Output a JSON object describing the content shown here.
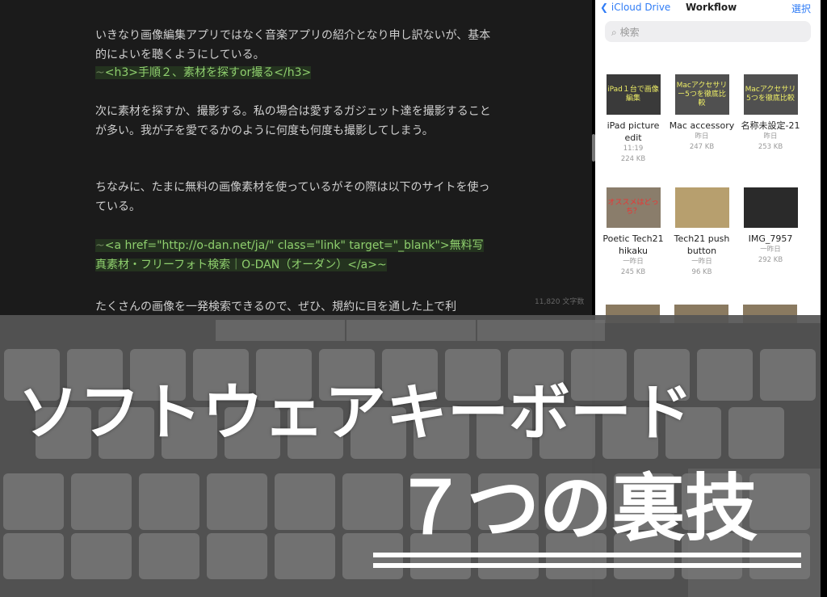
{
  "editor": {
    "paragraphs": [
      {
        "text": "いきなり画像編集アプリではなく音楽アプリの紹介となり申し訳ないが、基本的によいを聴くようにしている。"
      },
      {
        "tilde": "~",
        "text": "<h3>手順２、素材を探すor撮る</h3>"
      },
      {
        "text": "次に素材を探すか、撮影する。私の場合は愛するガジェット達を撮影することが多い。我が子を愛でるかのように何度も何度も撮影してしまう。"
      },
      {
        "text": "ちなみに、たまに無料の画像素材を使っているがその際は以下のサイトを使っている。"
      },
      {
        "tilde": "~",
        "text": "<a href=\"http://o-dan.net/ja/\" class=\"link\" target=\"_blank\">無料写真素材・フリーフォト検索｜O-DAN（オーダン）</a>~"
      },
      {
        "text": "たくさんの画像を一発検索できるので、ぜひ、規約に目を通した上で利"
      }
    ],
    "char_count": "11,820 文字数"
  },
  "files": {
    "back_label": "iCloud Drive",
    "title": "Workflow",
    "select_label": "選択",
    "search_placeholder": "検索",
    "items": [
      {
        "name": "iPad picture edit",
        "date": "11:19",
        "size": "224 KB",
        "thumb_text": "iPad１台で画像編集"
      },
      {
        "name": "Mac accessory",
        "date": "昨日",
        "size": "247 KB",
        "thumb_text": "Macアクセサリー5つを徹底比較"
      },
      {
        "name": "名称未設定-21",
        "date": "昨日",
        "size": "253 KB",
        "thumb_text": "Macアクセサリ5つを徹底比較"
      },
      {
        "name": "Poetic Tech21 hikaku",
        "date": "一昨日",
        "size": "245 KB",
        "thumb_text": "オススメはどっち？"
      },
      {
        "name": "Tech21 push button",
        "date": "一昨日",
        "size": "96 KB",
        "thumb_text": ""
      },
      {
        "name": "IMG_7957",
        "date": "一昨日",
        "size": "292 KB",
        "thumb_text": ""
      }
    ]
  },
  "overlay": {
    "title": "ソフトウェアキーボード",
    "subtitle": "７つの裏技"
  },
  "colors": {
    "accent": "#2f7cf6",
    "code_green": "#8fcf6e"
  }
}
